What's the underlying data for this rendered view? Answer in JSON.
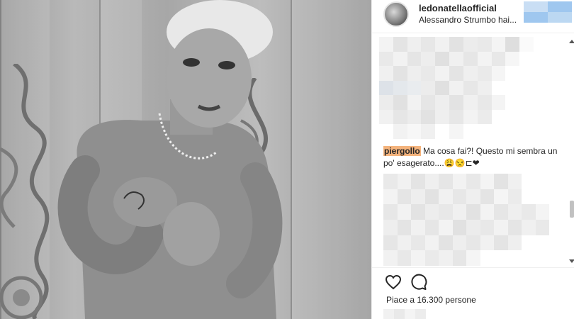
{
  "post": {
    "username": "ledonatellaofficial",
    "subtitle": "Alessandro Strumbo hai..."
  },
  "comment": {
    "user": "piergollo",
    "text": " Ma cosa fai?! Questo mi sembra un po' esagerato....😩😒⊏❤"
  },
  "actions": {
    "like_icon": "heart-icon",
    "comment_icon": "comment-icon"
  },
  "likes": {
    "text": "Piace a 16.300 persone"
  },
  "colors": {
    "highlight": "#f4b37c",
    "follow_button": "#9fc7ef"
  }
}
